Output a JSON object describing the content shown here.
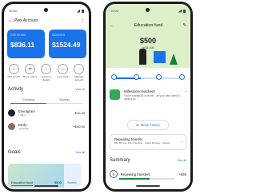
{
  "left_phone": {
    "status": {
      "time": "10:00"
    },
    "header": {
      "back": "←",
      "title": "Plex Account",
      "more": "⋮"
    },
    "cards": [
      {
        "label": "CHECKING",
        "amount": "$836.11"
      },
      {
        "label": "SAVINGS",
        "amount": "$1524.49"
      }
    ],
    "actions": [
      {
        "icon": "+",
        "label": "Add money"
      },
      {
        "icon": "⇄",
        "label": "Move money"
      },
      {
        "icon": "i",
        "label": "Account details"
      },
      {
        "icon": "▭",
        "label": "Lock card"
      },
      {
        "icon": "⋯",
        "label": "Manage account"
      }
    ],
    "activity": {
      "title": "Activity",
      "view_all": "View all",
      "tabs": [
        "Checking",
        "Savings"
      ],
      "items": [
        {
          "name": "Eventgram",
          "sub": "1 Days",
          "amount": "-$12.39",
          "avatar_color": "#202124"
        },
        {
          "name": "Emily",
          "sub": "Yesterday",
          "amount": "+$40.00",
          "avatar_color": "#8d6e63"
        }
      ]
    },
    "goals": {
      "title": "Goals",
      "view_all": "View all",
      "card": {
        "name": "Education fund",
        "amount": "$500",
        "progress": 0.45
      },
      "peek_label": "Summ"
    }
  },
  "right_phone": {
    "status": {
      "time": "10:00"
    },
    "header": {
      "back": "←",
      "title": "Education fund",
      "edit": "✎"
    },
    "amount": "$500",
    "amount_sub": "of $1,000",
    "progress": 0.4,
    "milestone": {
      "title": "Milestone reached!",
      "sub": "You're saving $X a month - all your hard work is adding up",
      "chevron": "›"
    },
    "move_button": {
      "icon": "⇄",
      "label": "Move money"
    },
    "repeating_card": {
      "title": "Repeating transfer",
      "sub": "$50.00 from Plex checking · Starts Monday · Weekly",
      "chevron": "›"
    },
    "summary": {
      "title": "Summary",
      "view_all": "View all",
      "row": {
        "label": "Repeating transfers",
        "amount": "+$45",
        "progress": 0.55
      }
    }
  }
}
